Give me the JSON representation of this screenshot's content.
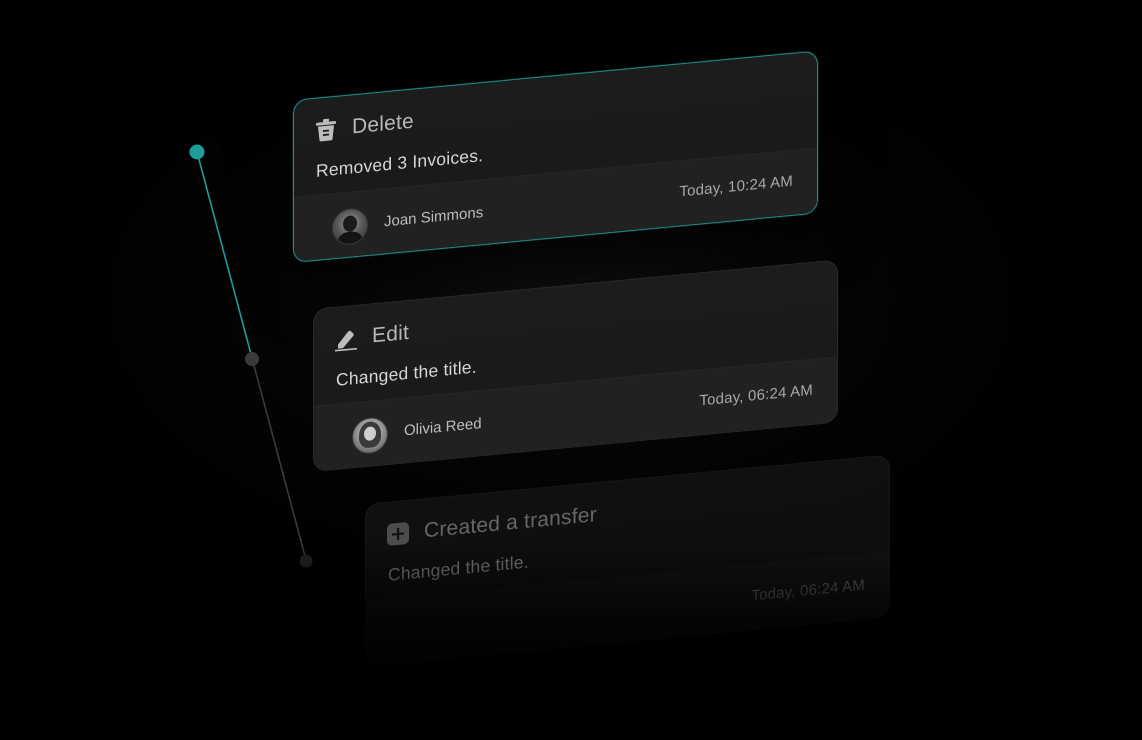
{
  "colors": {
    "accent": "#1e9d9a",
    "background": "#000000",
    "card": "#1b1b1b",
    "card_footer": "#212121"
  },
  "timeline": {
    "nodes": [
      "active",
      "inactive",
      "inactive"
    ]
  },
  "activities": [
    {
      "icon": "trash-icon",
      "title": "Delete",
      "description": "Removed 3 Invoices.",
      "user": "Joan Simmons",
      "time": "Today, 10:24 AM",
      "active": true
    },
    {
      "icon": "pencil-icon",
      "title": "Edit",
      "description": "Changed the title.",
      "user": "Olivia Reed",
      "time": "Today, 06:24 AM",
      "active": false
    },
    {
      "icon": "plus-square-icon",
      "title": "Created a transfer",
      "description": "Changed the title.",
      "user": "",
      "time": "Today, 06:24 AM",
      "active": false
    }
  ]
}
